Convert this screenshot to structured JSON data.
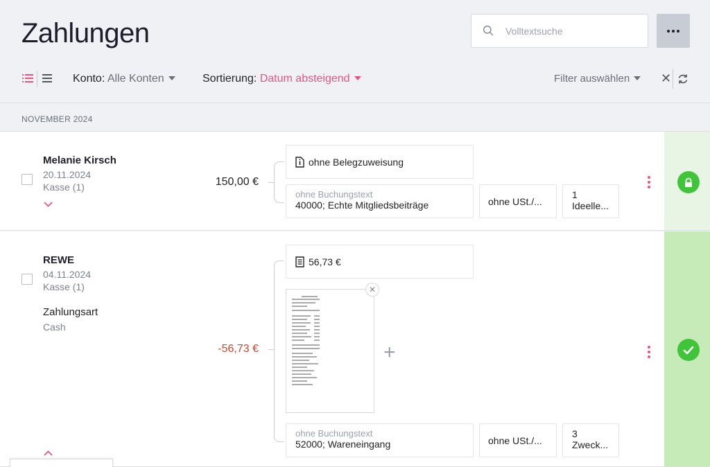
{
  "header": {
    "title": "Zahlungen",
    "search_placeholder": "Volltextsuche"
  },
  "toolbar": {
    "konto_label": "Konto:",
    "konto_value": "Alle Konten",
    "sort_label": "Sortierung:",
    "sort_value": "Datum absteigend",
    "filter_label": "Filter auswählen",
    "clear_label": "✕"
  },
  "month": "NOVEMBER 2024",
  "payments": [
    {
      "name": "Melanie Kirsch",
      "date": "20.11.2024",
      "account": "Kasse (1)",
      "amount": "150,00 €",
      "beleg": "ohne Belegzuweisung",
      "buchungstext": "ohne Buchungstext",
      "konto": "40000; Echte Mitgliedsbeiträge",
      "ust": "ohne USt./...",
      "sphere_num": "1",
      "sphere_name": "Ideelle..."
    },
    {
      "name": "REWE",
      "date": "04.11.2024",
      "account": "Kasse (1)",
      "payment_method_label": "Zahlungsart",
      "payment_method_value": "Cash",
      "amount": "-56,73 €",
      "beleg": "56,73 €",
      "buchungstext": "ohne Buchungstext",
      "konto": "52000; Wareneingang",
      "ust": "ohne USt./...",
      "sphere_num": "3",
      "sphere_name": "Zweck..."
    }
  ],
  "colors": {
    "accent": "#e8547e",
    "negative": "#d0452a",
    "success": "#3fc43a"
  }
}
